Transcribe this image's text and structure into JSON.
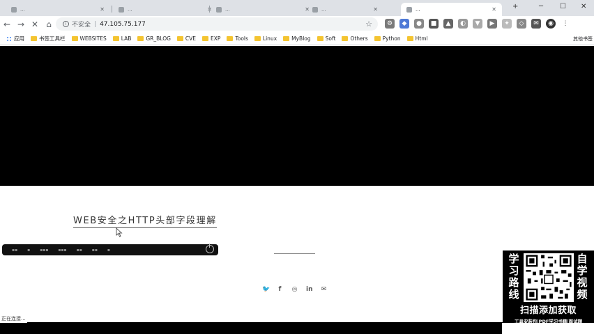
{
  "tabs": [
    {
      "title": "...",
      "active": false
    },
    {
      "title": "...",
      "active": false
    },
    {
      "title": "...",
      "active": false
    },
    {
      "title": "...",
      "active": false
    },
    {
      "title": "...",
      "active": true
    }
  ],
  "toolbar": {
    "insecure_label": "不安全",
    "url": "47.105.75.177"
  },
  "bookmarks": [
    {
      "label": "应用",
      "type": "apps"
    },
    {
      "label": "书签工具栏",
      "type": "folder"
    },
    {
      "label": "WEBSITES",
      "type": "folder"
    },
    {
      "label": "LAB",
      "type": "folder"
    },
    {
      "label": "GR_BLOG",
      "type": "folder"
    },
    {
      "label": "CVE",
      "type": "folder"
    },
    {
      "label": "EXP",
      "type": "folder"
    },
    {
      "label": "Tools",
      "type": "folder"
    },
    {
      "label": "Linux",
      "type": "folder"
    },
    {
      "label": "MyBlog",
      "type": "folder"
    },
    {
      "label": "Soft",
      "type": "folder"
    },
    {
      "label": "Others",
      "type": "folder"
    },
    {
      "label": "Python",
      "type": "folder"
    },
    {
      "label": "Html",
      "type": "folder"
    }
  ],
  "other_bookmarks": "其他书签",
  "page": {
    "post_title": "WEB安全之HTTP头部字段理解"
  },
  "social_icons": [
    "twitter-icon",
    "facebook-icon",
    "instagram-icon",
    "linkedin-icon",
    "email-icon"
  ],
  "status_text": "正在连接...",
  "promo": {
    "left_text": "学习路线",
    "right_text": "自学视频",
    "cta": "扫描添加获取",
    "sub": "工具安装包|PDF学习书籍|面试题"
  },
  "colors": {
    "hero": "#000000",
    "tabstrip": "#dee1e6",
    "omnibox": "#f1f3f4"
  }
}
